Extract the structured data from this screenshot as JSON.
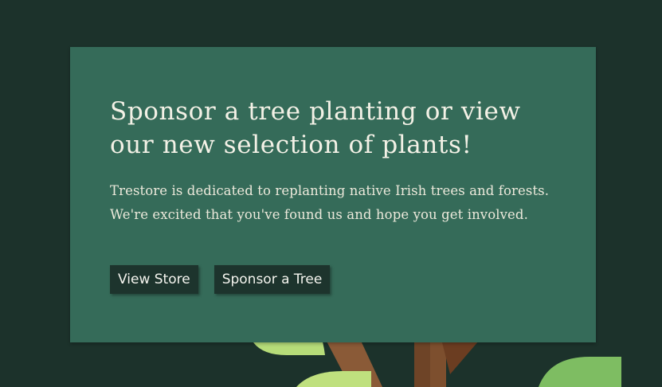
{
  "hero": {
    "heading": "Sponsor a tree planting or view our new selection of plants!",
    "body": "Trestore is dedicated to replanting native Irish trees and forests. We're excited that you've found us and hope you get involved.",
    "buttons": {
      "view_store": "View Store",
      "sponsor_tree": "Sponsor a Tree"
    }
  },
  "colors": {
    "background": "#1c322b",
    "card": "#356b59",
    "button": "#1d342d",
    "leaf_light": "#b6dc79",
    "leaf_mid": "#7ebd62",
    "trunk": "#7a4e2d",
    "trunk_dark": "#66391f"
  },
  "decor": {
    "illustration": "tree-illustration"
  }
}
